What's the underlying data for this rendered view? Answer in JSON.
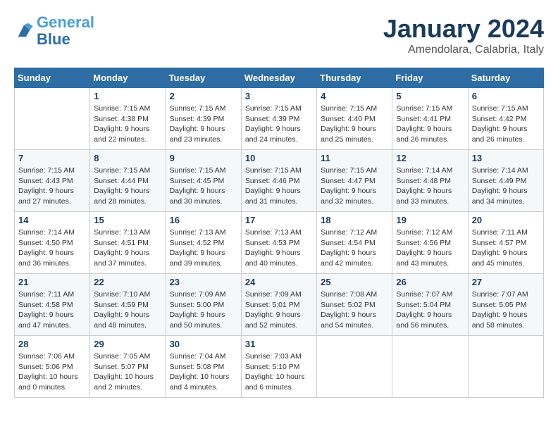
{
  "header": {
    "logo_line1": "General",
    "logo_line2": "Blue",
    "month_title": "January 2024",
    "location": "Amendolara, Calabria, Italy"
  },
  "calendar": {
    "days_of_week": [
      "Sunday",
      "Monday",
      "Tuesday",
      "Wednesday",
      "Thursday",
      "Friday",
      "Saturday"
    ],
    "weeks": [
      [
        {
          "day": "",
          "info": ""
        },
        {
          "day": "1",
          "info": "Sunrise: 7:15 AM\nSunset: 4:38 PM\nDaylight: 9 hours\nand 22 minutes."
        },
        {
          "day": "2",
          "info": "Sunrise: 7:15 AM\nSunset: 4:39 PM\nDaylight: 9 hours\nand 23 minutes."
        },
        {
          "day": "3",
          "info": "Sunrise: 7:15 AM\nSunset: 4:39 PM\nDaylight: 9 hours\nand 24 minutes."
        },
        {
          "day": "4",
          "info": "Sunrise: 7:15 AM\nSunset: 4:40 PM\nDaylight: 9 hours\nand 25 minutes."
        },
        {
          "day": "5",
          "info": "Sunrise: 7:15 AM\nSunset: 4:41 PM\nDaylight: 9 hours\nand 26 minutes."
        },
        {
          "day": "6",
          "info": "Sunrise: 7:15 AM\nSunset: 4:42 PM\nDaylight: 9 hours\nand 26 minutes."
        }
      ],
      [
        {
          "day": "7",
          "info": "Sunrise: 7:15 AM\nSunset: 4:43 PM\nDaylight: 9 hours\nand 27 minutes."
        },
        {
          "day": "8",
          "info": "Sunrise: 7:15 AM\nSunset: 4:44 PM\nDaylight: 9 hours\nand 28 minutes."
        },
        {
          "day": "9",
          "info": "Sunrise: 7:15 AM\nSunset: 4:45 PM\nDaylight: 9 hours\nand 30 minutes."
        },
        {
          "day": "10",
          "info": "Sunrise: 7:15 AM\nSunset: 4:46 PM\nDaylight: 9 hours\nand 31 minutes."
        },
        {
          "day": "11",
          "info": "Sunrise: 7:15 AM\nSunset: 4:47 PM\nDaylight: 9 hours\nand 32 minutes."
        },
        {
          "day": "12",
          "info": "Sunrise: 7:14 AM\nSunset: 4:48 PM\nDaylight: 9 hours\nand 33 minutes."
        },
        {
          "day": "13",
          "info": "Sunrise: 7:14 AM\nSunset: 4:49 PM\nDaylight: 9 hours\nand 34 minutes."
        }
      ],
      [
        {
          "day": "14",
          "info": "Sunrise: 7:14 AM\nSunset: 4:50 PM\nDaylight: 9 hours\nand 36 minutes."
        },
        {
          "day": "15",
          "info": "Sunrise: 7:13 AM\nSunset: 4:51 PM\nDaylight: 9 hours\nand 37 minutes."
        },
        {
          "day": "16",
          "info": "Sunrise: 7:13 AM\nSunset: 4:52 PM\nDaylight: 9 hours\nand 39 minutes."
        },
        {
          "day": "17",
          "info": "Sunrise: 7:13 AM\nSunset: 4:53 PM\nDaylight: 9 hours\nand 40 minutes."
        },
        {
          "day": "18",
          "info": "Sunrise: 7:12 AM\nSunset: 4:54 PM\nDaylight: 9 hours\nand 42 minutes."
        },
        {
          "day": "19",
          "info": "Sunrise: 7:12 AM\nSunset: 4:56 PM\nDaylight: 9 hours\nand 43 minutes."
        },
        {
          "day": "20",
          "info": "Sunrise: 7:11 AM\nSunset: 4:57 PM\nDaylight: 9 hours\nand 45 minutes."
        }
      ],
      [
        {
          "day": "21",
          "info": "Sunrise: 7:11 AM\nSunset: 4:58 PM\nDaylight: 9 hours\nand 47 minutes."
        },
        {
          "day": "22",
          "info": "Sunrise: 7:10 AM\nSunset: 4:59 PM\nDaylight: 9 hours\nand 48 minutes."
        },
        {
          "day": "23",
          "info": "Sunrise: 7:09 AM\nSunset: 5:00 PM\nDaylight: 9 hours\nand 50 minutes."
        },
        {
          "day": "24",
          "info": "Sunrise: 7:09 AM\nSunset: 5:01 PM\nDaylight: 9 hours\nand 52 minutes."
        },
        {
          "day": "25",
          "info": "Sunrise: 7:08 AM\nSunset: 5:02 PM\nDaylight: 9 hours\nand 54 minutes."
        },
        {
          "day": "26",
          "info": "Sunrise: 7:07 AM\nSunset: 5:04 PM\nDaylight: 9 hours\nand 56 minutes."
        },
        {
          "day": "27",
          "info": "Sunrise: 7:07 AM\nSunset: 5:05 PM\nDaylight: 9 hours\nand 58 minutes."
        }
      ],
      [
        {
          "day": "28",
          "info": "Sunrise: 7:06 AM\nSunset: 5:06 PM\nDaylight: 10 hours\nand 0 minutes."
        },
        {
          "day": "29",
          "info": "Sunrise: 7:05 AM\nSunset: 5:07 PM\nDaylight: 10 hours\nand 2 minutes."
        },
        {
          "day": "30",
          "info": "Sunrise: 7:04 AM\nSunset: 5:08 PM\nDaylight: 10 hours\nand 4 minutes."
        },
        {
          "day": "31",
          "info": "Sunrise: 7:03 AM\nSunset: 5:10 PM\nDaylight: 10 hours\nand 6 minutes."
        },
        {
          "day": "",
          "info": ""
        },
        {
          "day": "",
          "info": ""
        },
        {
          "day": "",
          "info": ""
        }
      ]
    ]
  }
}
